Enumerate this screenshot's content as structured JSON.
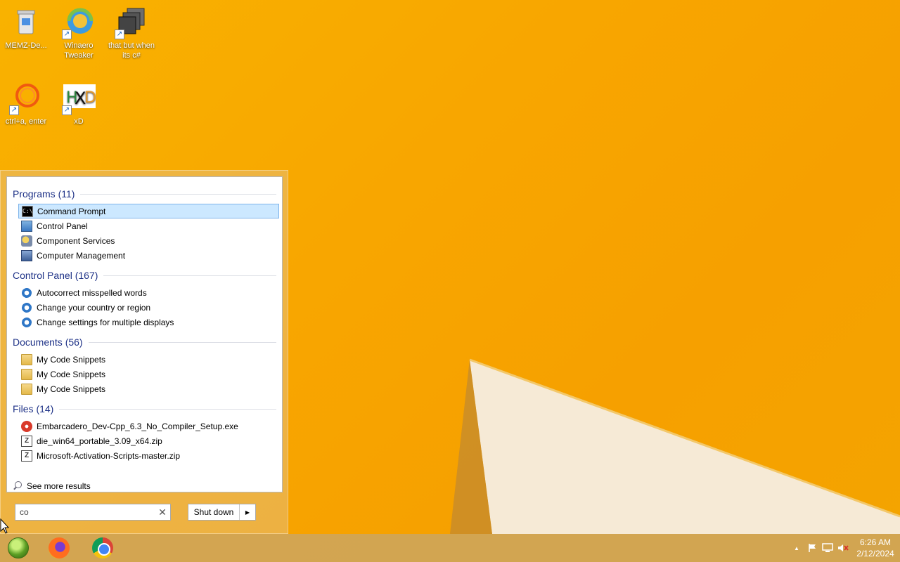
{
  "desktop": {
    "icons": [
      {
        "label": "MEMZ-De...",
        "icon": "recycle-bin-icon"
      },
      {
        "label": "Winaero Tweaker",
        "icon": "winaero-icon"
      },
      {
        "label": "that but when its c#",
        "icon": "stack-icon"
      },
      {
        "label": "ctrl+a, enter",
        "icon": "ring-icon"
      },
      {
        "label": "xD",
        "icon": "hxd-icon"
      }
    ]
  },
  "start_menu": {
    "groups": [
      {
        "title": "Programs (11)",
        "items": [
          {
            "label": "Command Prompt",
            "icon": "cmd-icon",
            "selected": true
          },
          {
            "label": "Control Panel",
            "icon": "control-panel-icon"
          },
          {
            "label": "Component Services",
            "icon": "component-services-icon"
          },
          {
            "label": "Computer Management",
            "icon": "computer-management-icon"
          }
        ]
      },
      {
        "title": "Control Panel (167)",
        "items": [
          {
            "label": "Autocorrect misspelled words",
            "icon": "gear-icon"
          },
          {
            "label": "Change your country or region",
            "icon": "gear-icon"
          },
          {
            "label": "Change settings for multiple displays",
            "icon": "gear-icon"
          }
        ]
      },
      {
        "title": "Documents (56)",
        "items": [
          {
            "label": "My Code Snippets",
            "icon": "folder-icon"
          },
          {
            "label": "My Code Snippets",
            "icon": "folder-icon"
          },
          {
            "label": "My Code Snippets",
            "icon": "folder-icon"
          }
        ]
      },
      {
        "title": "Files (14)",
        "items": [
          {
            "label": "Embarcadero_Dev-Cpp_6.3_No_Compiler_Setup.exe",
            "icon": "exe-icon"
          },
          {
            "label": "die_win64_portable_3.09_x64.zip",
            "icon": "zip-icon"
          },
          {
            "label": "Microsoft-Activation-Scripts-master.zip",
            "icon": "zip-icon"
          }
        ]
      }
    ],
    "see_more": "See more results",
    "search": {
      "value": "co",
      "clear_glyph": "✕"
    },
    "shutdown": {
      "label": "Shut down",
      "arrow": "▶"
    }
  },
  "taskbar": {
    "apps": [
      "start-orb-icon",
      "firefox-icon",
      "chrome-icon"
    ],
    "tray": {
      "time": "6:26 AM",
      "date": "2/12/2024",
      "up_arrow": "▲"
    }
  }
}
